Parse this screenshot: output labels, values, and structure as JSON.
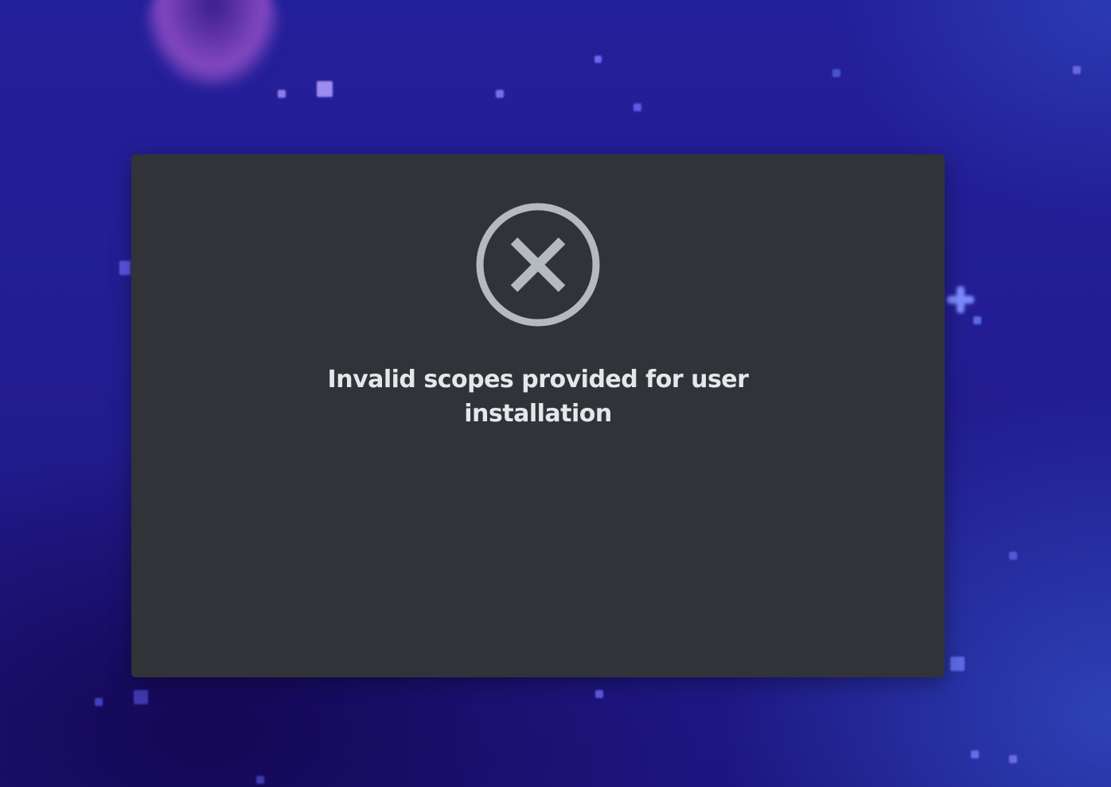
{
  "background": {
    "colors": {
      "base": "#1f1a86",
      "star": "#7d79ff",
      "sparkle": "#7d8bff"
    }
  },
  "modal": {
    "background_color": "#313338",
    "icon": {
      "name": "error-x-circle-icon",
      "color": "#b5babf"
    },
    "error_message": "Invalid scopes provided for user installation"
  }
}
